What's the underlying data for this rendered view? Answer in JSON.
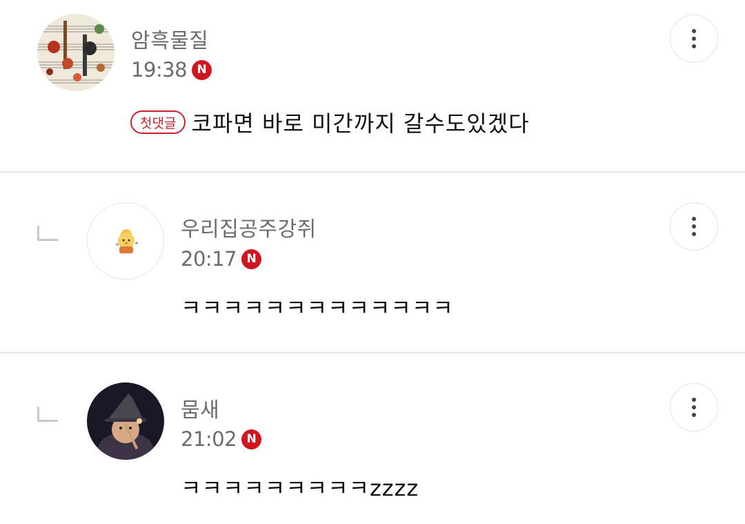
{
  "comments": [
    {
      "username": "암흑물질",
      "time": "19:38",
      "badge": "N",
      "first_comment_label": "첫댓글",
      "text": "코파면 바로 미간까지 갈수도있겠다"
    },
    {
      "username": "우리집공주강쥐",
      "time": "20:17",
      "badge": "N",
      "text": "ㅋㅋㅋㅋㅋㅋㅋㅋㅋㅋㅋㅋㅋ"
    },
    {
      "username": "뭄새",
      "time": "21:02",
      "badge": "N",
      "text": "ㅋㅋㅋㅋㅋㅋㅋㅋㅋzzzz"
    }
  ],
  "icons": {
    "more": "more-vertical-icon",
    "new": "new-badge-icon",
    "reply": "reply-arrow-icon"
  },
  "colors": {
    "badge_red": "#d0161e",
    "first_badge": "#c8202a",
    "meta_gray": "#6b6b6b",
    "divider": "#e6e6e6"
  }
}
